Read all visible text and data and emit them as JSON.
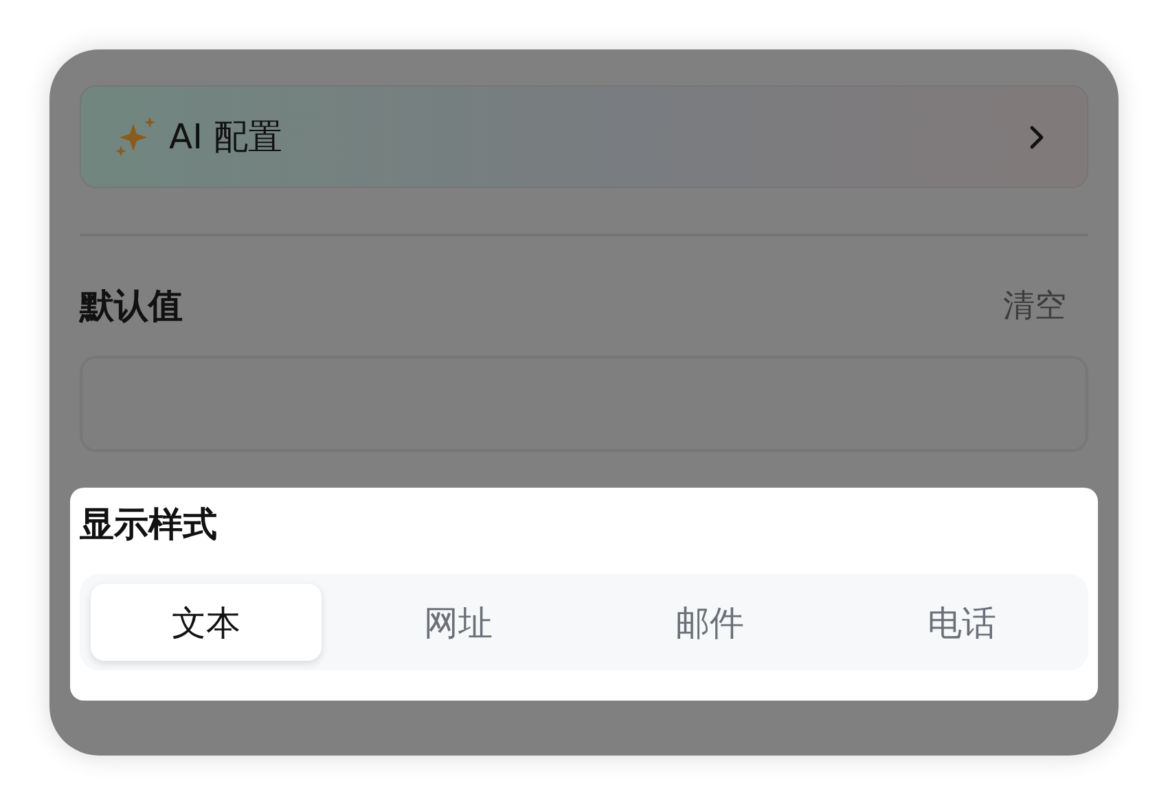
{
  "ai_config": {
    "label": "AI 配置"
  },
  "default_value": {
    "label": "默认值",
    "clear": "清空"
  },
  "display_style": {
    "label": "显示样式",
    "options": [
      {
        "label": "文本",
        "selected": true
      },
      {
        "label": "网址",
        "selected": false
      },
      {
        "label": "邮件",
        "selected": false
      },
      {
        "label": "电话",
        "selected": false
      }
    ]
  }
}
